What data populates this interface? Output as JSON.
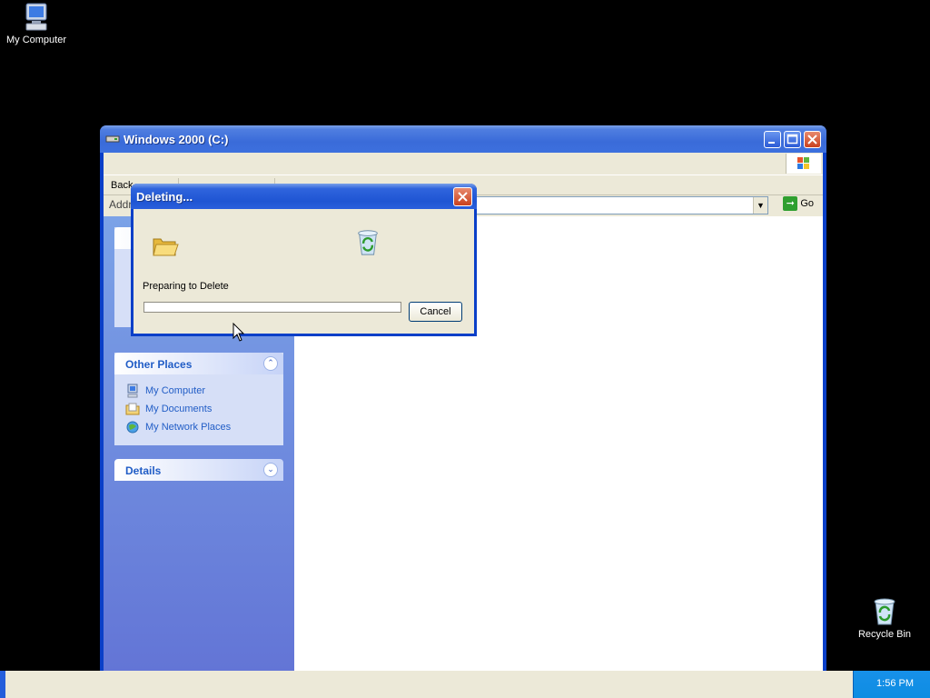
{
  "desktop": {
    "icons": [
      {
        "label": "My Computer",
        "icon": "my-computer-icon"
      },
      {
        "label": "Recycle Bin",
        "icon": "recycle-bin-icon"
      }
    ]
  },
  "window": {
    "title": "Windows 2000 (C:)",
    "toolbar": {
      "back_label": "Back"
    },
    "address": {
      "label": "Address",
      "go_label": "Go",
      "value": ""
    },
    "sidebar": {
      "other_places": {
        "title": "Other Places",
        "items": [
          {
            "label": "My Computer",
            "icon": "my-computer-icon"
          },
          {
            "label": "My Documents",
            "icon": "my-documents-icon"
          },
          {
            "label": "My Network Places",
            "icon": "network-places-icon"
          }
        ]
      },
      "details": {
        "title": "Details"
      }
    }
  },
  "dialog": {
    "title": "Deleting...",
    "status": "Preparing to Delete",
    "progress": 0,
    "cancel_label": "Cancel"
  },
  "taskbar": {
    "clock": "1:56 PM"
  },
  "colors": {
    "titlebar": "#0a3fc8",
    "sidepane": "#6375d6",
    "link": "#215dc6",
    "taskbar_tray": "#0e8de2"
  }
}
